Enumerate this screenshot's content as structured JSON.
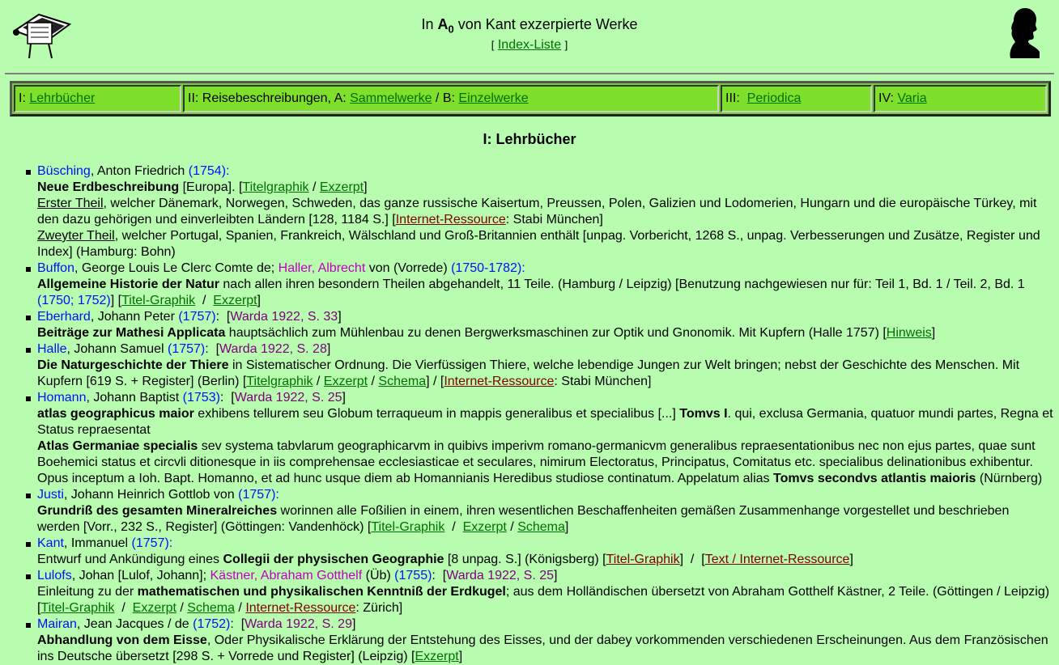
{
  "header": {
    "title_pre": "In ",
    "title_a": "A",
    "title_sub": "0",
    "title_post": " von Kant exzerpierte Werke",
    "index_link": "Index-Liste",
    "bracket_open": "[",
    "bracket_close": "]"
  },
  "navbar": {
    "cell1_prefix": "I: ",
    "cell1_link": "Lehrbücher",
    "cell2_prefix": "II: Reisebeschreibungen, A: ",
    "cell2_link1": "Sammelwerke",
    "cell2_mid": " / B: ",
    "cell2_link2": "Einzelwerke",
    "cell3_prefix": "III:  ",
    "cell3_link": "Periodica",
    "cell4_prefix": "IV: ",
    "cell4_link": "Varia"
  },
  "section_title": "I: Lehrbücher",
  "entries": [
    {
      "author": "Büsching",
      "author_rest": ", Anton Friedrich ",
      "year": "(1754)",
      "colon": ":",
      "l1_bold": "Neue Erdbeschreibung",
      "l1_rest": " [Europa]. [",
      "l1_link1": "Titelgraphik",
      "l1_sep": " / ",
      "l1_link2": "Exzerpt",
      "l1_end": "]",
      "p1_u": "Erster Theil",
      "p1_rest": ", welcher Dänemark, Norwegen, Schweden, das ganze russische Kaisertum, Preussen, Polen, Galizien und Lodomerien, Hungarn und die europäische Türkey, mit den dazu gehörigen und einverleibten Ländern [128, 1184 S.] [",
      "p1_link": "Internet-Ressource",
      "p1_end": ": Stabi München]",
      "p2_u": "Zweyter Theil",
      "p2_rest": ", welcher Portugal, Spanien, Frankreich, Wälschland und Groß-Britannien enthält [unpag. Vorbericht, 1268 S., unpag. Verbesserungen und Zusätze, Register und Index] (Hamburg: Bohn)"
    },
    {
      "author": "Buffon",
      "author_rest": ", George Louis Le Clerc Comte de; ",
      "author2": "Haller, Albrecht",
      "author2_rest": " von (Vorrede) ",
      "year": "(1750-1782)",
      "colon": ":",
      "bold": "Allgemeine Historie der Natur",
      "rest": " nach allen ihren besondern Theilen abgehandelt, 11 Teile. (Hamburg / Leipzig) [Benutzung nachgewiesen nur für: Teil 1, Bd. 1 / Teil. 2, Bd. 1 ",
      "yr2": "(1750; 1752)",
      "rest2": "] [",
      "link1": "Titel-Graphik",
      "sep": "  /  ",
      "link2": "Exzerpt",
      "end": "]"
    },
    {
      "author": "Eberhard",
      "author_rest": ", Johann Peter ",
      "year": "(1757)",
      "colon": ":  [",
      "warda": "Warda 1922, S. 33",
      "warda_end": "]",
      "bold": "Beiträge zur Mathesi Applicata",
      "rest": " hauptsächlich zum Mühlenbau zu denen Bergwerksmaschinen zur Optik und Gnonomik. Mit Kupfern (Halle 1757)  [",
      "link1": "Hinweis",
      "end": "]"
    },
    {
      "author": "Halle",
      "author_rest": ", Johann Samuel ",
      "year": "(1757)",
      "colon": ":  [",
      "warda": "Warda 1922, S. 28",
      "warda_end": "]",
      "bold": "Die Naturgeschichte der Thiere",
      "rest": " in Sistematischer Ordnung. Die Vierfüssigen Thiere, welche lebendige Jungen zur Welt bringen; nebst der Geschichte des Menschen. Mit Kupfern [619 S. + Register] (Berlin) [",
      "link1": "Titelgraphik",
      "sep1": " / ",
      "link2": "Exzerpt",
      "sep2": " / ",
      "link3": "Schema",
      "mid": "] / [",
      "res": "Internet-Ressource",
      "end": ": Stabi München]"
    },
    {
      "author": "Homann",
      "author_rest": ", Johann Baptist ",
      "year": "(1753)",
      "colon": ":  [",
      "warda": "Warda 1922, S. 25",
      "warda_end": "]",
      "bold1": "atlas geographicus maior",
      "rest1": " exhibens tellurem seu Globum terraqueum in mappis generalibus et specialibus [...] ",
      "bold1b": "Tomvs I",
      "rest1b": ". qui, exclusa Germania, quatuor mundi partes, Regna et Status repraesentat",
      "bold2": "Atlas Germaniae specialis",
      "rest2": " sev systema tabvlarum geographicarvm in quibivs imperivm romano-germanicvm generalibus repraesentationibus nec non ejus partes, quae sunt Boehemici status et circvli ditionesque in iis comprehensae ecclesiasticae et seculares, nimirum Electoratus, Principatus, Comitatus etc. specialibus delinationibus exhibentur. Opus inceptum a Ioh. Bapt. Homanno, et ad hunc usque diem ab Homannianis Heredibus studiose continatum. Appelatum alias ",
      "bold2b": "Tomvs secondvs atlantis maioris",
      "rest2b": " (Nürnberg)"
    },
    {
      "author": "Justi",
      "author_rest": ", Johann Heinrich Gottlob von ",
      "year": "(1757)",
      "colon": ":",
      "bold": "Grundriß des gesamten Mineralreiches",
      "rest": " worinnen alle Foßilien in einem, ihren wesentlichen Beschaffenheiten gemäßen Zusammenhange vorgestellet und beschrieben werden [Vorr., 232 S., Register] (Göttingen: Vandenhöck) [",
      "link1": "Titel-Graphik",
      "sep1": "  /  ",
      "link2": "Exzerpt",
      "sep2": " / ",
      "link3": "Schema",
      "end": "]"
    },
    {
      "author": "Kant",
      "author_rest": ", Immanuel ",
      "year": "(1757)",
      "colon": ":",
      "pre": "Entwurf und Ankündigung eines ",
      "bold": "Collegii der physischen Geographie",
      "rest": " [8 unpag. S.] (Königsberg) [",
      "res1": "Titel-Graphik",
      "mid": "]  /  [",
      "res2": "Text / Internet-Ressource",
      "end": "]"
    },
    {
      "author": "Lulofs",
      "author_rest": ", Johan [Lulof, Johann]; ",
      "author2": "Kästner, Abraham Gotthelf",
      "author2_rest": " (Üb) ",
      "year": "(1755)",
      "colon": ":  [",
      "warda": "Warda 1922, S. 25",
      "warda_end": "]",
      "pre": "Einleitung zu der ",
      "bold": "mathematischen und physikalischen Kenntniß der Erdkugel",
      "rest": "; aus dem Holländischen übersetzt von Abraham Gotthelf Kästner, 2 Teile. (Göttingen / Leipzig) [",
      "link1": "Titel-Graphik",
      "sep1": "  /  ",
      "link2": "Exzerpt",
      "sep2": " / ",
      "link3": "Schema",
      "sep3": " / ",
      "res": "Internet-Ressource",
      "end": ": Zürich]"
    },
    {
      "author": "Mairan",
      "author_rest": ", Jean Jacques / de ",
      "year": "(1752)",
      "colon": ":  [",
      "warda": "Warda 1922, S. 29",
      "warda_end": "]",
      "bold": "Abhandlung von dem Eisse",
      "rest": ", Oder Physikalische Erklärung der Entstehung des Eisses, und der dabey vorkommenden verschiedenen Erscheinungen. Aus dem Französischen ins Deutsche übersetzt [298 S. + Vorrede und Register] (Leipzig) [",
      "link1": "Exzerpt",
      "end": "]"
    }
  ]
}
